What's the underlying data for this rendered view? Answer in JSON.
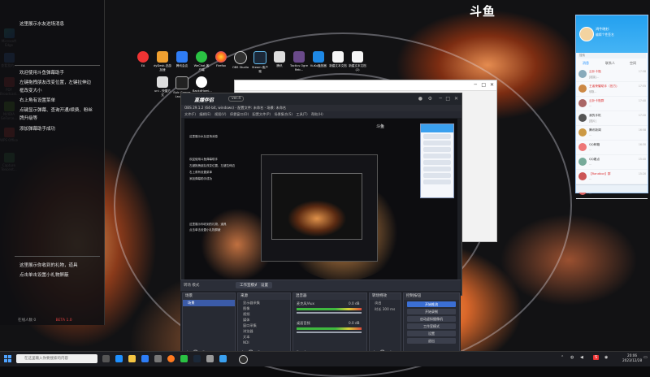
{
  "brand": {
    "logo": "斗鱼"
  },
  "left_panel": {
    "lines": [
      "这里展示水友进场消息",
      "欢迎使用斗鱼弹幕助手",
      "左键拖拽朋友改变位置，左键拉伸边",
      "框改变大小",
      "右上角有设置菜单",
      "点键显示弹幕、查询开通/续费、粉丝",
      "牌升级等",
      "添加弹幕助手成功"
    ],
    "bottom_lines": [
      "这里展示你收到的礼物，道具",
      "点击单击设置小礼物屏蔽"
    ],
    "footer": {
      "left": "在线人数 0",
      "right": "BETA 1.0"
    }
  },
  "desktop_left_icons": [
    "Microsoft Edge",
    "查看我的...",
    "PDF Broadcast...",
    "NVIDIA GeForce...",
    "WPS Office",
    "Capture Tencent..."
  ],
  "desktop_top_icons": [
    "EA",
    "dyDesk-迅游加速",
    "腾讯会议",
    "WeChat 客户端",
    "Firefox",
    "OBS Studio",
    "Steam 客户端",
    "腾讯",
    "Tactics Ogre Reb...",
    "KuKu播放器",
    "新建文本文档",
    "新建文本文档(2)"
  ],
  "desktop_top_icons_row2": [
    "uni - 快捷方式",
    "Epic Games Launcher",
    "BackdHomi..."
  ],
  "douyu_window": {
    "logo": "直播伴侣",
    "badge": "ver.4",
    "title": "OBS 29.1.2 (64-bit, windows) - 配置文件: 未命名 - 场景: 未命名",
    "menu": [
      "文件(F)",
      "编辑(E)",
      "视图(V)",
      "停靠窗口(D)",
      "配置文件(P)",
      "场景集合(S)",
      "工具(T)",
      "帮助(H)"
    ]
  },
  "obs": {
    "mode_label": "转场 模式",
    "tab_studio": "工作室模式",
    "tab_settings": "设置",
    "scenes": {
      "title": "场景",
      "items": [
        "场景"
      ]
    },
    "sources": {
      "title": "来源",
      "items": [
        "显示器采集",
        "图像",
        "视频",
        "媒体",
        "窗口采集",
        "浏览器",
        "文本",
        "NDI"
      ]
    },
    "mixer": {
      "title": "混音器",
      "tracks": [
        {
          "name": "麦克风/Aux",
          "db": "0.0 dB"
        },
        {
          "name": "桌面音频",
          "db": "0.0 dB"
        }
      ]
    },
    "transitions": {
      "title": "转场特效",
      "type": "淡出",
      "duration_label": "时长",
      "duration": "300 ms"
    },
    "controls": {
      "title": "控制按钮",
      "buttons": [
        "开始推流",
        "开始录制",
        "启动虚拟摄像机",
        "工作室模式",
        "设置",
        "退出"
      ]
    }
  },
  "qq": {
    "nick": "鸿牛晓杉",
    "sign": "编辑个性签名",
    "search": "搜索",
    "tabs": [
      "消息",
      "联系人",
      "空间"
    ],
    "conversations": [
      {
        "name": "云补卡瓶",
        "msg": "[链接]...",
        "time": "17:58",
        "color": "#d33"
      },
      {
        "name": "王者荣耀助手（官方)",
        "msg": "领取...",
        "time": "17:55",
        "color": "#d33"
      },
      {
        "name": "云补卡瓶群",
        "msg": "...",
        "time": "17:40",
        "color": "#d33"
      },
      {
        "name": "我的手机",
        "msg": "[图片]",
        "time": "17:20",
        "color": "#333"
      },
      {
        "name": "腾讯新闻",
        "msg": "...",
        "time": "16:58",
        "color": "#333"
      },
      {
        "name": "QQ邮箱",
        "msg": "...",
        "time": "16:30",
        "color": "#333"
      },
      {
        "name": "QQ看点",
        "msg": "...",
        "time": "15:40",
        "color": "#333"
      },
      {
        "name": "【Randbor】群",
        "msg": "...",
        "time": "15:20",
        "color": "#d33"
      },
      {
        "name": "QQ钱包",
        "msg": "...",
        "time": "14:50",
        "color": "#d33"
      }
    ]
  },
  "taskbar": {
    "search_placeholder": "在这里输入你要搜索的内容",
    "clock_time": "20:06",
    "clock_date": "2023/12/28"
  }
}
